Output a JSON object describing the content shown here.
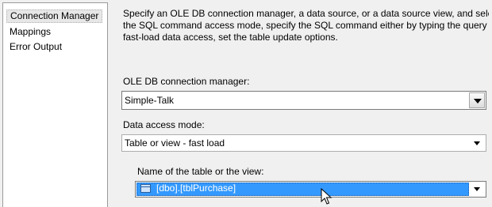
{
  "sidebar": {
    "items": [
      {
        "label": "Connection Manager",
        "selected": true
      },
      {
        "label": "Mappings",
        "selected": false
      },
      {
        "label": "Error Output",
        "selected": false
      }
    ]
  },
  "main": {
    "description": [
      "Specify an OLE DB connection manager, a data source, or a data source view, and select the da",
      "the SQL command access mode, specify the SQL command either by typing the query or by u",
      "fast-load data access, set the table update options."
    ],
    "connection_manager": {
      "label": "OLE DB connection manager:",
      "value": "Simple-Talk"
    },
    "data_access_mode": {
      "label": "Data access mode:",
      "value": "Table or view - fast load"
    },
    "table_or_view": {
      "label": "Name of the table or the view:",
      "value": "[dbo].[tblPurchase]",
      "icon": "table-icon"
    }
  },
  "colors": {
    "selection": "#3399ff",
    "background": "#f0f0f0"
  }
}
